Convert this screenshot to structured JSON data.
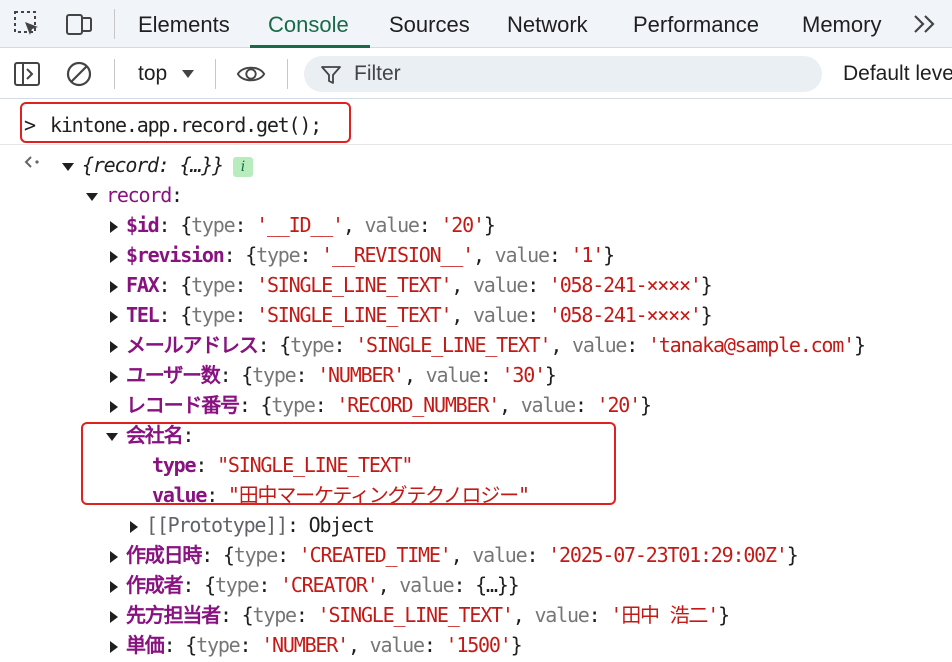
{
  "tabs": [
    {
      "label": "Elements"
    },
    {
      "label": "Console"
    },
    {
      "label": "Sources"
    },
    {
      "label": "Network"
    },
    {
      "label": "Performance"
    },
    {
      "label": "Memory"
    }
  ],
  "active_tab": "Console",
  "toolbar": {
    "context": "top",
    "filter_placeholder": "Filter",
    "levels": "Default levels"
  },
  "console": {
    "input_prompt": ">",
    "input": "kintone.app.record.get();",
    "result_arrow_icon": "return-arrow-icon",
    "root_summary": "{record: {…}}",
    "root_badge": "i",
    "record_key": "record",
    "fields": [
      {
        "key": "$id",
        "type": "__ID__",
        "value": "20"
      },
      {
        "key": "$revision",
        "type": "__REVISION__",
        "value": "1"
      },
      {
        "key": "FAX",
        "type": "SINGLE_LINE_TEXT",
        "value": "058-241-××××"
      },
      {
        "key": "TEL",
        "type": "SINGLE_LINE_TEXT",
        "value": "058-241-××××"
      },
      {
        "key": "メールアドレス",
        "type": "SINGLE_LINE_TEXT",
        "value": "tanaka@sample.com"
      },
      {
        "key": "ユーザー数",
        "type": "NUMBER",
        "value": "30"
      },
      {
        "key": "レコード番号",
        "type": "RECORD_NUMBER",
        "value": "20"
      }
    ],
    "expanded_field": {
      "key": "会社名",
      "type": "\"SINGLE_LINE_TEXT\"",
      "value": "\"田中マーケティングテクノロジー\"",
      "prototype_label": "[[Prototype]]",
      "prototype_value": "Object"
    },
    "fields_after": [
      {
        "key": "作成日時",
        "type": "CREATED_TIME",
        "value": "2025-07-23T01:29:00Z",
        "summary": ""
      },
      {
        "key": "作成者",
        "type": "CREATOR",
        "value": "",
        "summary": "{…}"
      },
      {
        "key": "先方担当者",
        "type": "SINGLE_LINE_TEXT",
        "value": "田中 浩二",
        "summary": ""
      },
      {
        "key": "単価",
        "type": "NUMBER",
        "value": "1500",
        "summary": ""
      }
    ]
  },
  "colors": {
    "accent": "#1a6a49",
    "highlight_box": "#e0211f",
    "key": "#881280",
    "string": "#c41a16"
  }
}
